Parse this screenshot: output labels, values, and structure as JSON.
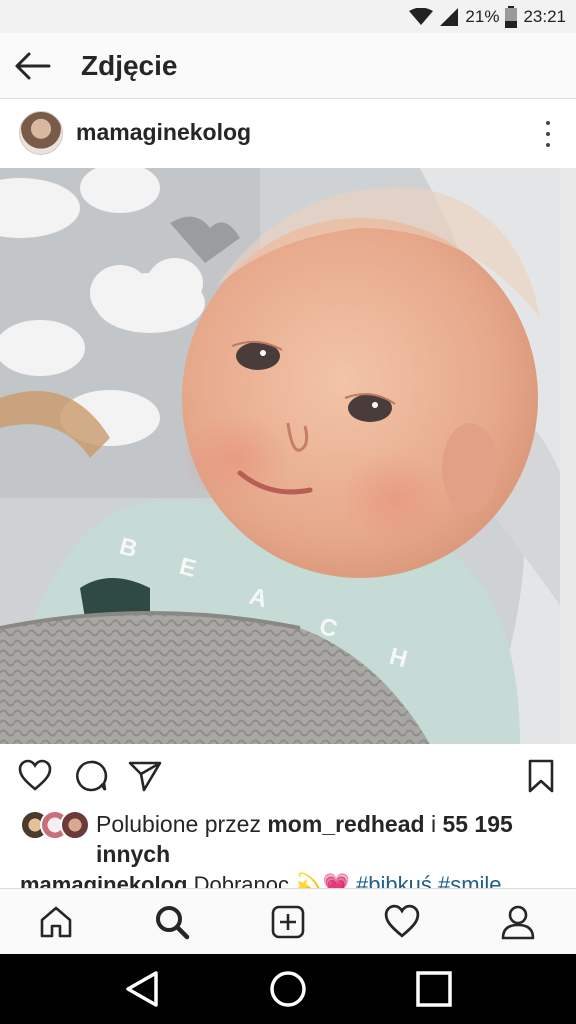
{
  "status_bar": {
    "battery_percent": "21%",
    "time": "23:21",
    "icons": [
      "wifi-icon",
      "cellular-signal-icon",
      "battery-icon"
    ]
  },
  "header": {
    "title": "Zdjęcie",
    "back_icon": "arrow-left-icon"
  },
  "post": {
    "username": "mamaginekolog",
    "more_icon": "vertical-dots-icon",
    "photo_text": [
      "B",
      "E",
      "A",
      "C",
      "H"
    ],
    "actions": [
      "heart-icon",
      "comment-icon",
      "send-icon",
      "bookmark-icon"
    ],
    "likes": {
      "prefix": "Polubione przez ",
      "user": "mom_redhead",
      "joiner": " i ",
      "count": "55 195",
      "suffix": "innych"
    },
    "caption": {
      "username": "mamaginekolog",
      "text": " Dobranoc ",
      "emoji": "💫💗",
      "hashtags": "#bibkuś #smile"
    }
  },
  "bottom_nav": [
    "home-icon",
    "search-icon",
    "add-icon",
    "activity-heart-icon",
    "profile-icon"
  ],
  "system_nav": [
    "back-triangle-icon",
    "home-circle-icon",
    "recents-square-icon"
  ],
  "colors": {
    "accent": "#262626",
    "hashtag": "#1f5f8b",
    "statusbar": "#f2f2f2"
  }
}
